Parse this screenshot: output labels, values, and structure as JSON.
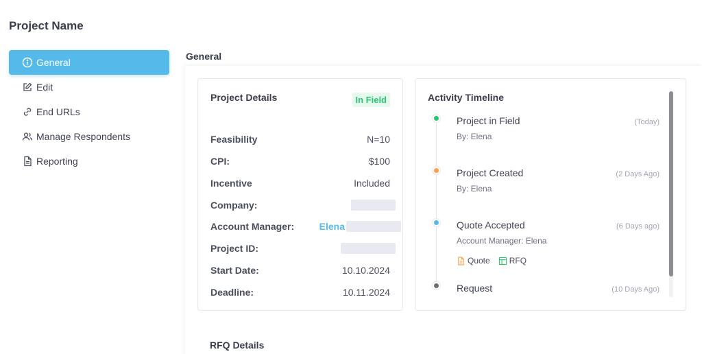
{
  "page": {
    "title": "Project Name"
  },
  "sidebar": {
    "items": [
      {
        "label": "General",
        "icon": "info-icon",
        "active": true
      },
      {
        "label": "Edit",
        "icon": "edit-icon",
        "active": false
      },
      {
        "label": "End URLs",
        "icon": "link-icon",
        "active": false
      },
      {
        "label": "Manage Respondents",
        "icon": "users-icon",
        "active": false
      },
      {
        "label": "Reporting",
        "icon": "document-icon",
        "active": false
      }
    ]
  },
  "main": {
    "section_title": "General",
    "details": {
      "title": "Project Details",
      "status": "In Field",
      "rows": [
        {
          "label": "Feasibility",
          "value": "N=10"
        },
        {
          "label": "CPI:",
          "value": "$100"
        },
        {
          "label": "Incentive",
          "value": "Included"
        },
        {
          "label": "Company:",
          "value": ""
        },
        {
          "label": "Account Manager:",
          "value": "Elena"
        },
        {
          "label": "Project ID:",
          "value": ""
        },
        {
          "label": "Start Date:",
          "value": "10.10.2024"
        },
        {
          "label": "Deadline:",
          "value": "10.11.2024"
        }
      ]
    },
    "timeline": {
      "title": "Activity Timeline",
      "events": [
        {
          "name": "Project in Field",
          "when": "(Today)",
          "sub": "By: Elena",
          "dot_color": "#28c76f"
        },
        {
          "name": "Project Created",
          "when": "(2 Days Ago)",
          "sub": "By: Elena",
          "dot_color": "#ff9f43"
        },
        {
          "name": "Quote Accepted",
          "when": "(6 Days ago)",
          "sub": "Account Manager: Elena",
          "dot_color": "#55b9ea",
          "docs": [
            {
              "label": "Quote",
              "color": "#ff9f43"
            },
            {
              "label": "RFQ",
              "color": "#28c76f"
            }
          ]
        },
        {
          "name": "Request",
          "when": "(10 Days Ago)",
          "sub": "",
          "dot_color": "#6e6e76"
        }
      ]
    },
    "rfq": {
      "title": "RFQ Details"
    }
  },
  "colors": {
    "accent": "#55b9ea",
    "success": "#28c76f",
    "warning": "#ff9f43"
  }
}
